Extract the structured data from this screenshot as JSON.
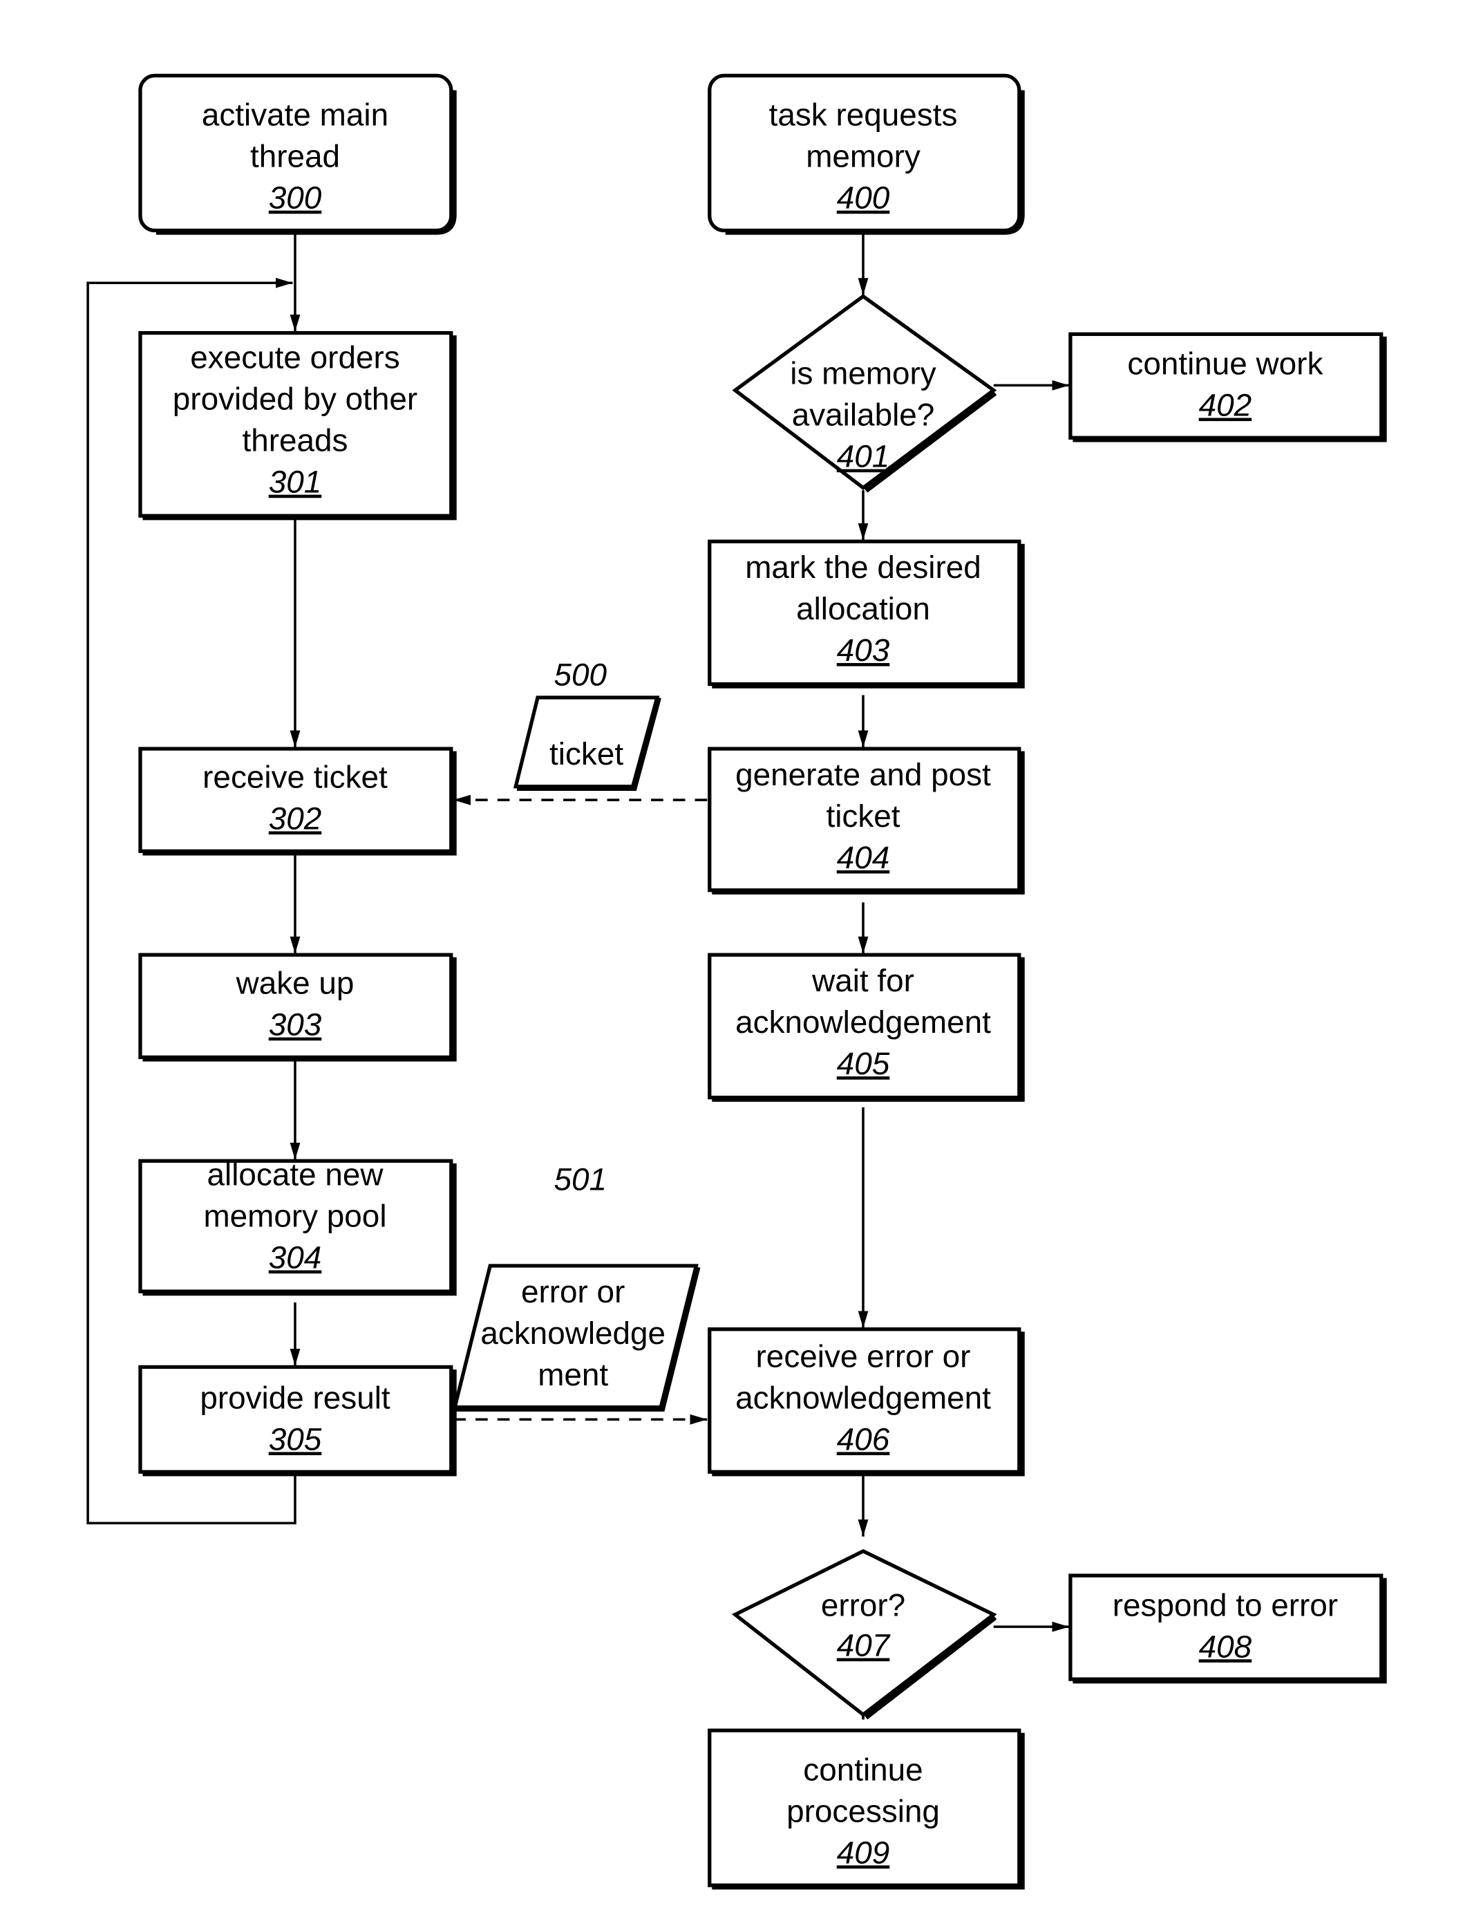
{
  "nodes": {
    "n300": {
      "lines": [
        "activate main",
        "thread"
      ],
      "ref": "300"
    },
    "n301": {
      "lines": [
        "execute orders",
        "provided by other",
        "threads"
      ],
      "ref": "301"
    },
    "n302": {
      "lines": [
        "receive ticket"
      ],
      "ref": "302"
    },
    "n303": {
      "lines": [
        "wake up"
      ],
      "ref": "303"
    },
    "n304": {
      "lines": [
        "allocate new",
        "memory pool"
      ],
      "ref": "304"
    },
    "n305": {
      "lines": [
        "provide result"
      ],
      "ref": "305"
    },
    "n400": {
      "lines": [
        "task requests",
        "memory"
      ],
      "ref": "400"
    },
    "n401": {
      "lines": [
        "is memory",
        "available?"
      ],
      "ref": "401"
    },
    "n402": {
      "lines": [
        "continue work"
      ],
      "ref": "402"
    },
    "n403": {
      "lines": [
        "mark the desired",
        "allocation"
      ],
      "ref": "403"
    },
    "n404": {
      "lines": [
        "generate and post",
        "ticket"
      ],
      "ref": "404"
    },
    "n405": {
      "lines": [
        "wait for",
        "acknowledgement"
      ],
      "ref": "405"
    },
    "n406": {
      "lines": [
        "receive error or",
        "acknowledgement"
      ],
      "ref": "406"
    },
    "n407": {
      "lines": [
        "error?"
      ],
      "ref": "407"
    },
    "n408": {
      "lines": [
        "respond to error"
      ],
      "ref": "408"
    },
    "n409": {
      "lines": [
        "continue",
        "processing"
      ],
      "ref": "409"
    }
  },
  "messages": {
    "m500": {
      "lines": [
        "ticket"
      ],
      "ref": "500"
    },
    "m501": {
      "lines": [
        "error or",
        "acknowledge",
        "ment"
      ],
      "ref": "501"
    }
  }
}
